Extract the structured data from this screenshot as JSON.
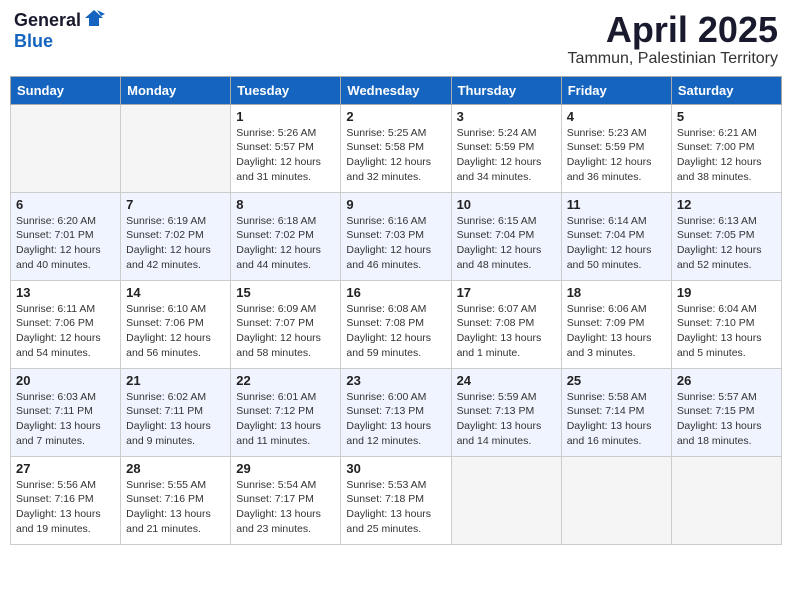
{
  "logo": {
    "general": "General",
    "blue": "Blue"
  },
  "title": {
    "month_year": "April 2025",
    "location": "Tammun, Palestinian Territory"
  },
  "headers": [
    "Sunday",
    "Monday",
    "Tuesday",
    "Wednesday",
    "Thursday",
    "Friday",
    "Saturday"
  ],
  "weeks": [
    [
      {
        "day": "",
        "info": ""
      },
      {
        "day": "",
        "info": ""
      },
      {
        "day": "1",
        "info": "Sunrise: 5:26 AM\nSunset: 5:57 PM\nDaylight: 12 hours\nand 31 minutes."
      },
      {
        "day": "2",
        "info": "Sunrise: 5:25 AM\nSunset: 5:58 PM\nDaylight: 12 hours\nand 32 minutes."
      },
      {
        "day": "3",
        "info": "Sunrise: 5:24 AM\nSunset: 5:59 PM\nDaylight: 12 hours\nand 34 minutes."
      },
      {
        "day": "4",
        "info": "Sunrise: 5:23 AM\nSunset: 5:59 PM\nDaylight: 12 hours\nand 36 minutes."
      },
      {
        "day": "5",
        "info": "Sunrise: 6:21 AM\nSunset: 7:00 PM\nDaylight: 12 hours\nand 38 minutes."
      }
    ],
    [
      {
        "day": "6",
        "info": "Sunrise: 6:20 AM\nSunset: 7:01 PM\nDaylight: 12 hours\nand 40 minutes."
      },
      {
        "day": "7",
        "info": "Sunrise: 6:19 AM\nSunset: 7:02 PM\nDaylight: 12 hours\nand 42 minutes."
      },
      {
        "day": "8",
        "info": "Sunrise: 6:18 AM\nSunset: 7:02 PM\nDaylight: 12 hours\nand 44 minutes."
      },
      {
        "day": "9",
        "info": "Sunrise: 6:16 AM\nSunset: 7:03 PM\nDaylight: 12 hours\nand 46 minutes."
      },
      {
        "day": "10",
        "info": "Sunrise: 6:15 AM\nSunset: 7:04 PM\nDaylight: 12 hours\nand 48 minutes."
      },
      {
        "day": "11",
        "info": "Sunrise: 6:14 AM\nSunset: 7:04 PM\nDaylight: 12 hours\nand 50 minutes."
      },
      {
        "day": "12",
        "info": "Sunrise: 6:13 AM\nSunset: 7:05 PM\nDaylight: 12 hours\nand 52 minutes."
      }
    ],
    [
      {
        "day": "13",
        "info": "Sunrise: 6:11 AM\nSunset: 7:06 PM\nDaylight: 12 hours\nand 54 minutes."
      },
      {
        "day": "14",
        "info": "Sunrise: 6:10 AM\nSunset: 7:06 PM\nDaylight: 12 hours\nand 56 minutes."
      },
      {
        "day": "15",
        "info": "Sunrise: 6:09 AM\nSunset: 7:07 PM\nDaylight: 12 hours\nand 58 minutes."
      },
      {
        "day": "16",
        "info": "Sunrise: 6:08 AM\nSunset: 7:08 PM\nDaylight: 12 hours\nand 59 minutes."
      },
      {
        "day": "17",
        "info": "Sunrise: 6:07 AM\nSunset: 7:08 PM\nDaylight: 13 hours\nand 1 minute."
      },
      {
        "day": "18",
        "info": "Sunrise: 6:06 AM\nSunset: 7:09 PM\nDaylight: 13 hours\nand 3 minutes."
      },
      {
        "day": "19",
        "info": "Sunrise: 6:04 AM\nSunset: 7:10 PM\nDaylight: 13 hours\nand 5 minutes."
      }
    ],
    [
      {
        "day": "20",
        "info": "Sunrise: 6:03 AM\nSunset: 7:11 PM\nDaylight: 13 hours\nand 7 minutes."
      },
      {
        "day": "21",
        "info": "Sunrise: 6:02 AM\nSunset: 7:11 PM\nDaylight: 13 hours\nand 9 minutes."
      },
      {
        "day": "22",
        "info": "Sunrise: 6:01 AM\nSunset: 7:12 PM\nDaylight: 13 hours\nand 11 minutes."
      },
      {
        "day": "23",
        "info": "Sunrise: 6:00 AM\nSunset: 7:13 PM\nDaylight: 13 hours\nand 12 minutes."
      },
      {
        "day": "24",
        "info": "Sunrise: 5:59 AM\nSunset: 7:13 PM\nDaylight: 13 hours\nand 14 minutes."
      },
      {
        "day": "25",
        "info": "Sunrise: 5:58 AM\nSunset: 7:14 PM\nDaylight: 13 hours\nand 16 minutes."
      },
      {
        "day": "26",
        "info": "Sunrise: 5:57 AM\nSunset: 7:15 PM\nDaylight: 13 hours\nand 18 minutes."
      }
    ],
    [
      {
        "day": "27",
        "info": "Sunrise: 5:56 AM\nSunset: 7:16 PM\nDaylight: 13 hours\nand 19 minutes."
      },
      {
        "day": "28",
        "info": "Sunrise: 5:55 AM\nSunset: 7:16 PM\nDaylight: 13 hours\nand 21 minutes."
      },
      {
        "day": "29",
        "info": "Sunrise: 5:54 AM\nSunset: 7:17 PM\nDaylight: 13 hours\nand 23 minutes."
      },
      {
        "day": "30",
        "info": "Sunrise: 5:53 AM\nSunset: 7:18 PM\nDaylight: 13 hours\nand 25 minutes."
      },
      {
        "day": "",
        "info": ""
      },
      {
        "day": "",
        "info": ""
      },
      {
        "day": "",
        "info": ""
      }
    ]
  ]
}
